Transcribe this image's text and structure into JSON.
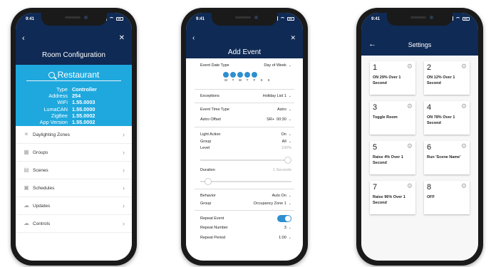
{
  "status_time": "9:41",
  "screen1": {
    "back_icon": "chevron-left-icon",
    "close_icon": "close-icon",
    "title": "Room Configuration",
    "room_name": "Restaurant",
    "info": [
      {
        "key": "Type",
        "value": "Controller"
      },
      {
        "key": "Address",
        "value": "254"
      },
      {
        "key": "WiFi",
        "value": "1.55.0003"
      },
      {
        "key": "LumaCAN",
        "value": "1.55.0000"
      },
      {
        "key": "ZigBee",
        "value": "1.55.0002"
      },
      {
        "key": "App Version",
        "value": "1.55.0002"
      }
    ],
    "menu": [
      {
        "label": "Daylighting Zones",
        "icon": "sun-icon"
      },
      {
        "label": "Groups",
        "icon": "groups-icon"
      },
      {
        "label": "Scenes",
        "icon": "scenes-icon"
      },
      {
        "label": "Schedules",
        "icon": "calendar-icon"
      },
      {
        "label": "Updates",
        "icon": "cloud-icon"
      },
      {
        "label": "Controls",
        "icon": "controls-icon"
      }
    ]
  },
  "screen2": {
    "title": "Add Event",
    "event_date_type": {
      "label": "Event Date Type",
      "value": "Day of Week"
    },
    "days": [
      "M",
      "T",
      "W",
      "T",
      "F",
      "S",
      "S"
    ],
    "days_selected": [
      true,
      true,
      true,
      true,
      true,
      false,
      false
    ],
    "exceptions": {
      "label": "Exceptions",
      "value": "Holiday List 1"
    },
    "event_time_type": {
      "label": "Event Time Type",
      "value": "Astro"
    },
    "astro_offset": {
      "label": "Astro Offset",
      "value1": "SR+",
      "value2": "00:30"
    },
    "light_action": {
      "label": "Light Action",
      "value": "On"
    },
    "group1": {
      "label": "Group",
      "value": "All"
    },
    "level": {
      "label": "Level",
      "value": "100%",
      "fraction": 1.0
    },
    "duration": {
      "label": "Duration",
      "value": "1 Seconds",
      "fraction": 0.05
    },
    "behavior": {
      "label": "Behavior",
      "value": "Auto On"
    },
    "group2": {
      "label": "Group",
      "value": "Occupancy Zone 1"
    },
    "repeat_event": {
      "label": "Repeat Event",
      "on": true
    },
    "repeat_number": {
      "label": "Repeat Number",
      "value": "3"
    },
    "repeat_period": {
      "label": "Repeat Period",
      "value": "1:00"
    }
  },
  "screen3": {
    "back_icon": "arrow-left-icon",
    "title": "Settings",
    "cards": [
      {
        "num": "1",
        "label": "ON 29% Over 1 Second"
      },
      {
        "num": "2",
        "label": "ON 12% Over 1 Second"
      },
      {
        "num": "3",
        "label": "Toggle Room"
      },
      {
        "num": "4",
        "label": "ON 78% Over 1 Second"
      },
      {
        "num": "5",
        "label": "Raise 4% Over 1 Second"
      },
      {
        "num": "6",
        "label": "Run 'Scene Name'"
      },
      {
        "num": "7",
        "label": "Raise 96% Over 1 Second"
      },
      {
        "num": "8",
        "label": "OFF"
      }
    ]
  }
}
